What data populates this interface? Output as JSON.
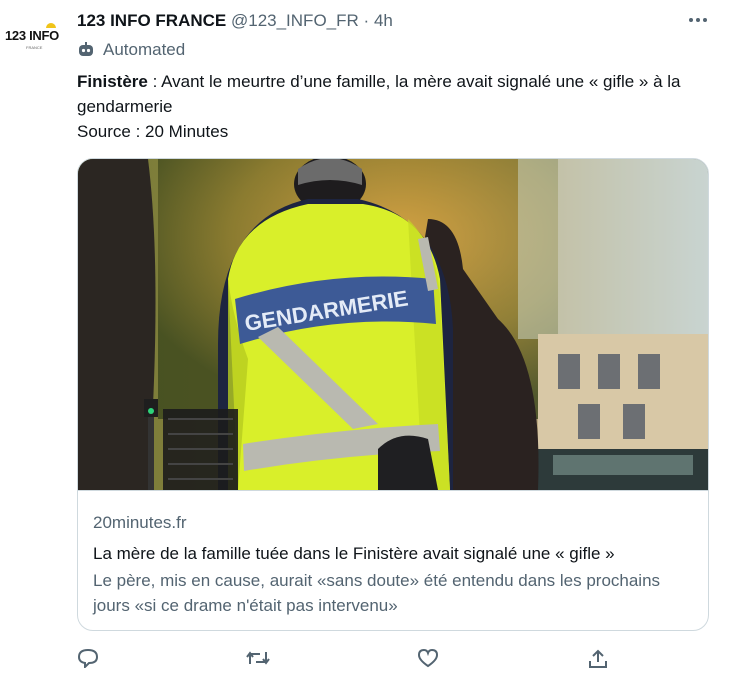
{
  "account": {
    "display_name": "123 INFO FRANCE",
    "handle": "@123_INFO_FR",
    "separator": "·",
    "time": "4h",
    "avatar_logo_text": "123 INFO",
    "avatar_logo_sub": "FRANCE"
  },
  "automated_label": "Automated",
  "tweet": {
    "bold_prefix": "Finistère",
    "text_rest": " : Avant le meurtre d’une famille, la mère avait signalé une « gifle » à la gendarmerie",
    "source_line": "Source : 20 Minutes"
  },
  "card": {
    "image_vest_text": "GENDARMERIE",
    "domain": "20minutes.fr",
    "title": "La mère de la famille tuée dans le Finistère avait signalé une « gifle »",
    "description": "Le père, mis en cause, aurait «sans doute» été entendu dans les prochains jours «si ce drame n'était pas intervenu»"
  },
  "actions": [
    {
      "name": "reply-icon"
    },
    {
      "name": "retweet-icon"
    },
    {
      "name": "like-icon"
    },
    {
      "name": "share-icon"
    }
  ],
  "colors": {
    "text_primary": "#0f1419",
    "text_secondary": "#536471",
    "border": "#cfd9de",
    "vest_yellow": "#d9ef2a",
    "vest_band": "#3d5a96"
  }
}
